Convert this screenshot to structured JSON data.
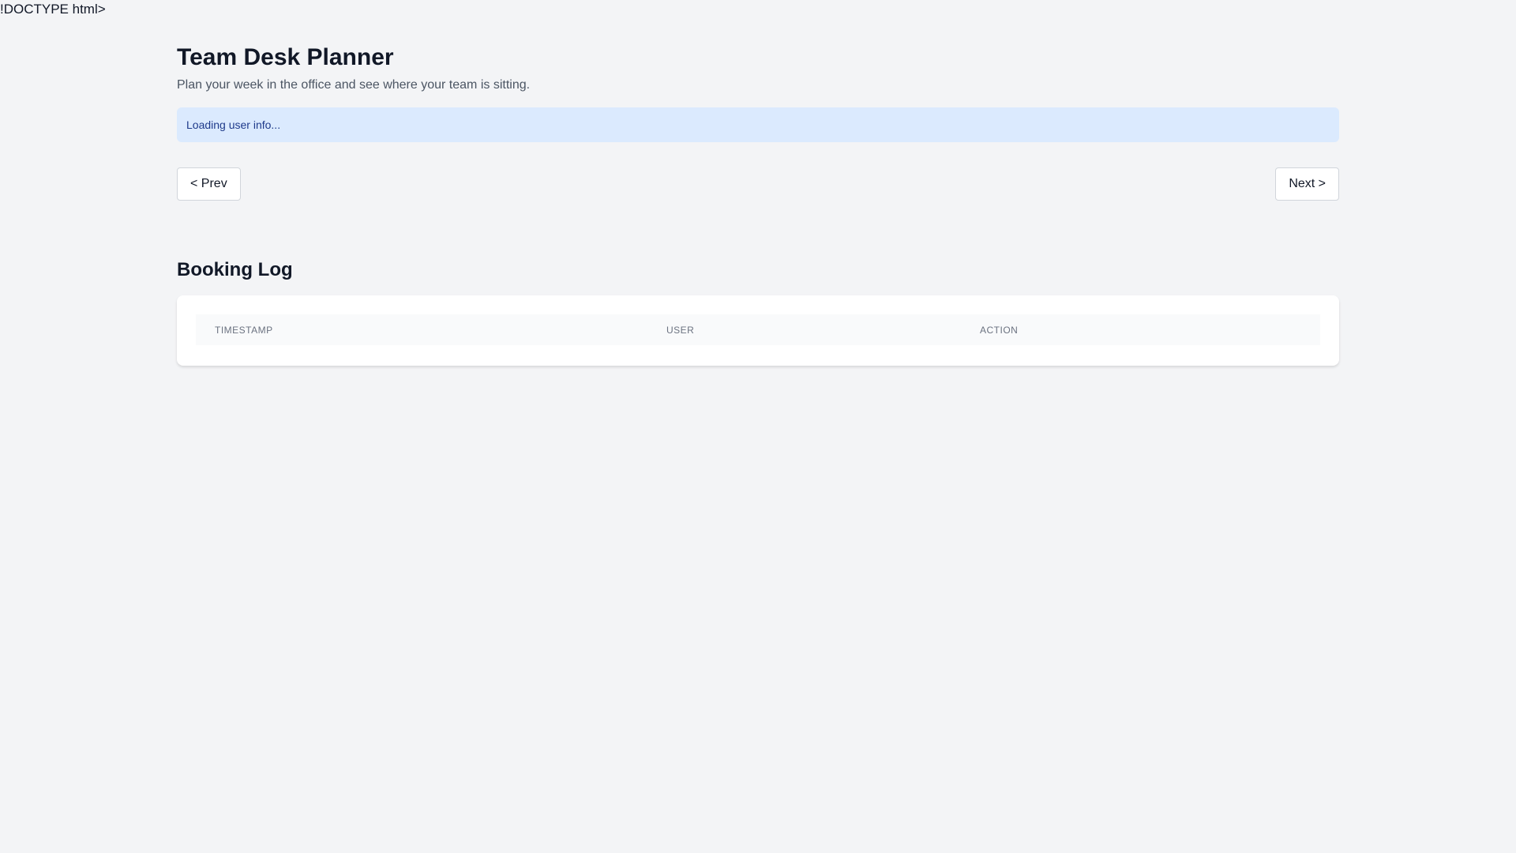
{
  "artifact": {
    "doctype_text": "!DOCTYPE html>"
  },
  "header": {
    "title": "Team Desk Planner",
    "subtitle": "Plan your week in the office and see where your team is sitting."
  },
  "status": {
    "message": "Loading user info..."
  },
  "nav": {
    "prev_label": "< Prev",
    "next_label": "Next >"
  },
  "booking_log": {
    "title": "Booking Log",
    "columns": [
      "TIMESTAMP",
      "USER",
      "ACTION"
    ],
    "rows": []
  },
  "colors": {
    "background": "#f3f4f6",
    "banner_bg": "#dbeafe",
    "banner_text": "#1e3a8a",
    "card_bg": "#ffffff",
    "table_header_bg": "#f9fafb"
  }
}
